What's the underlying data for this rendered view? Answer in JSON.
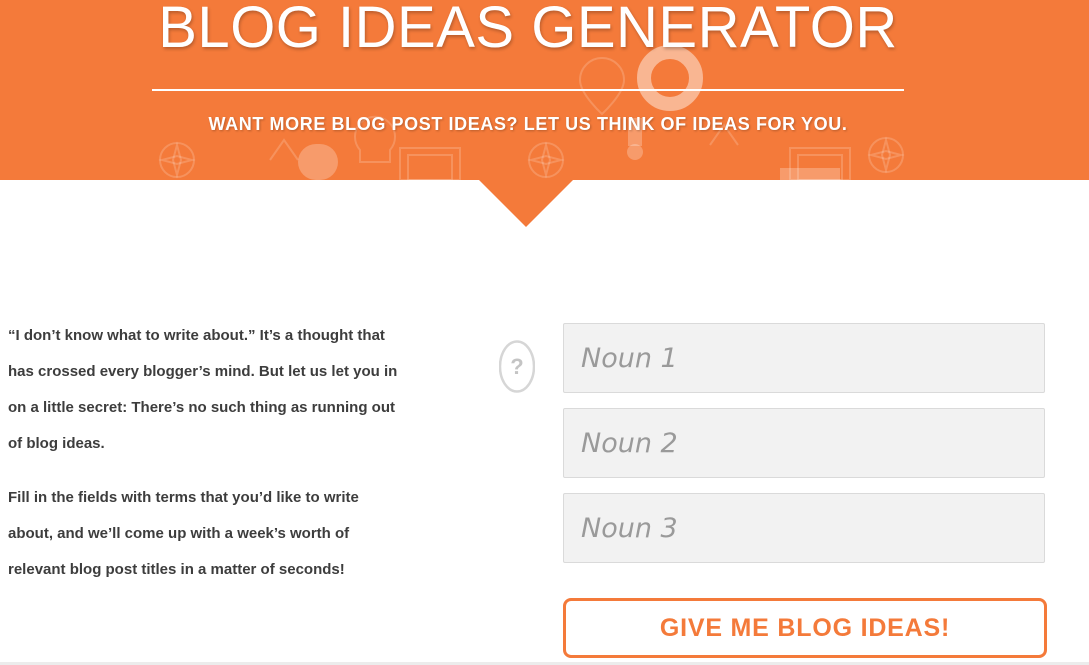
{
  "hero": {
    "title": "BLOG IDEAS GENERATOR",
    "subtitle": "WANT MORE BLOG POST IDEAS? LET US THINK OF IDEAS FOR YOU.",
    "background_color": "#f47a3a",
    "pattern_icons": [
      "compass-icon",
      "lightbulb-icon",
      "question-mark-icon",
      "picture-frame-icon",
      "map-pin-icon"
    ]
  },
  "intro": {
    "paragraph_1": "“I don’t know what to write about.” It’s a thought that has crossed every blogger’s mind. But let us let you in on a little secret: There’s no such thing as running out of blog ideas.",
    "paragraph_2": "Fill in the fields with terms that you’d like to write about, and we’ll come up with a week’s worth of relevant blog post titles in a matter of seconds!"
  },
  "form": {
    "help_icon": "question-circle-icon",
    "help_glyph": "?",
    "fields": [
      {
        "placeholder": "Noun 1",
        "value": ""
      },
      {
        "placeholder": "Noun 2",
        "value": ""
      },
      {
        "placeholder": "Noun 3",
        "value": ""
      }
    ],
    "submit_label": "GIVE ME BLOG IDEAS!",
    "accent_color": "#f47a3a"
  }
}
